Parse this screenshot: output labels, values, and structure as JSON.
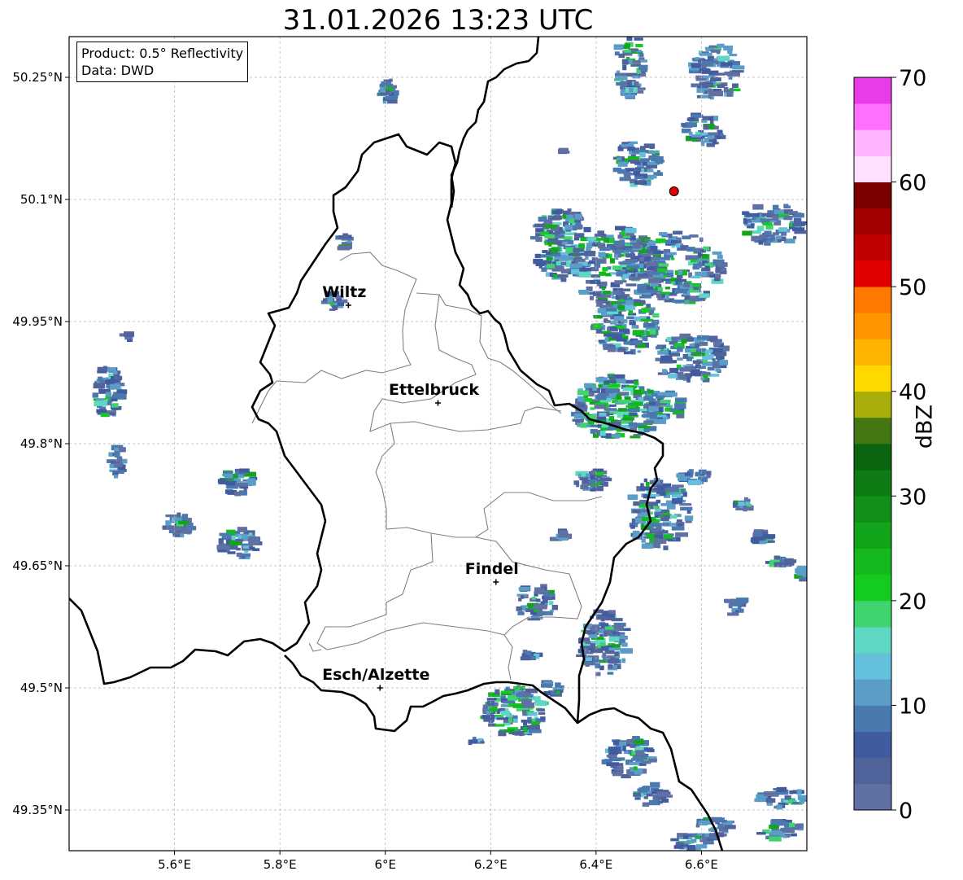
{
  "title": "31.01.2026 13:23 UTC",
  "info": {
    "product": "Product: 0.5° Reflectivity",
    "data": "Data: DWD"
  },
  "map": {
    "lon_range": [
      5.4,
      6.8
    ],
    "lat_range": [
      49.3,
      50.3
    ],
    "lon_ticks": [
      {
        "value": 5.6,
        "label": "5.6°E"
      },
      {
        "value": 5.8,
        "label": "5.8°E"
      },
      {
        "value": 6.0,
        "label": "6°E"
      },
      {
        "value": 6.2,
        "label": "6.2°E"
      },
      {
        "value": 6.4,
        "label": "6.4°E"
      },
      {
        "value": 6.6,
        "label": "6.6°E"
      }
    ],
    "lat_ticks": [
      {
        "value": 49.35,
        "label": "49.35°N"
      },
      {
        "value": 49.5,
        "label": "49.5°N"
      },
      {
        "value": 49.65,
        "label": "49.65°N"
      },
      {
        "value": 49.8,
        "label": "49.8°N"
      },
      {
        "value": 49.95,
        "label": "49.95°N"
      },
      {
        "value": 50.1,
        "label": "50.1°N"
      },
      {
        "value": 50.25,
        "label": "50.25°N"
      }
    ],
    "cities": [
      {
        "name": "Wiltz",
        "lon": 5.93,
        "lat": 49.97
      },
      {
        "name": "Ettelbruck",
        "lon": 6.1,
        "lat": 49.85
      },
      {
        "name": "Findel",
        "lon": 6.21,
        "lat": 49.63
      },
      {
        "name": "Esch/Alzette",
        "lon": 5.99,
        "lat": 49.5
      }
    ],
    "radar_site": {
      "lon": 6.548,
      "lat": 50.11
    },
    "colors": {
      "border": "#000000",
      "admin": "#808080",
      "grid": "#b0b0b0",
      "site": "#e00000"
    }
  },
  "colorbar": {
    "label": "dBZ",
    "min": 0,
    "max": 70,
    "ticks": [
      {
        "value": 0,
        "label": "0"
      },
      {
        "value": 10,
        "label": "10"
      },
      {
        "value": 20,
        "label": "20"
      },
      {
        "value": 30,
        "label": "30"
      },
      {
        "value": 40,
        "label": "40"
      },
      {
        "value": 50,
        "label": "50"
      },
      {
        "value": 60,
        "label": "60"
      },
      {
        "value": 70,
        "label": "70"
      }
    ],
    "colors": [
      "#6170a3",
      "#51639b",
      "#415ba0",
      "#4a79b0",
      "#5a9ec8",
      "#65c0dc",
      "#5fd8c3",
      "#3fd46e",
      "#13cc1f",
      "#13b91e",
      "#12a51b",
      "#118f18",
      "#0e7b14",
      "#0b6410",
      "#427712",
      "#a8af0a",
      "#ffd800",
      "#ffb400",
      "#ff9600",
      "#ff7800",
      "#e00000",
      "#c00000",
      "#a00000",
      "#7a0000",
      "#ffe0ff",
      "#ffb5ff",
      "#ff70ff",
      "#e83ce8"
    ]
  }
}
